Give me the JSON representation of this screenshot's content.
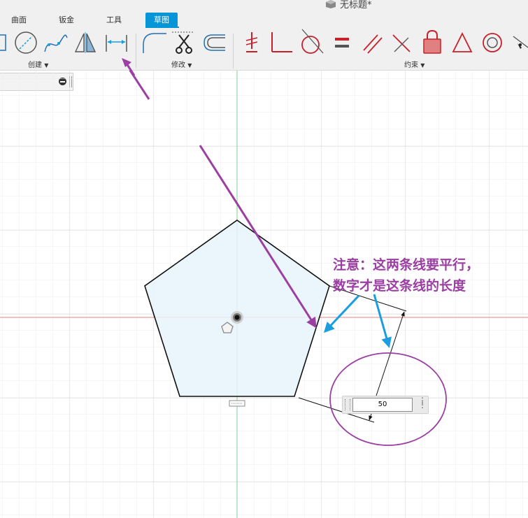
{
  "app": {
    "document_title": "无标题*"
  },
  "tabs": [
    {
      "label": "曲面",
      "active": false
    },
    {
      "label": "钣金",
      "active": false
    },
    {
      "label": "工具",
      "active": false
    },
    {
      "label": "草图",
      "active": true
    }
  ],
  "toolbar_groups": {
    "create": "创建",
    "modify": "修改",
    "constraints": "约束"
  },
  "dimension": {
    "value": "50"
  },
  "annotation": {
    "line1": "注意：这两条线要平行，",
    "line2": "数字才是这条线的长度"
  },
  "colors": {
    "accent": "#0696d7",
    "annotation": "#9b3fa2",
    "blue_arrow": "#1a9ee0",
    "x_axis": "#e88080",
    "y_axis": "#7fd08f",
    "sketch_fill": "#e8f3fb",
    "constraint_red": "#c8202a"
  }
}
